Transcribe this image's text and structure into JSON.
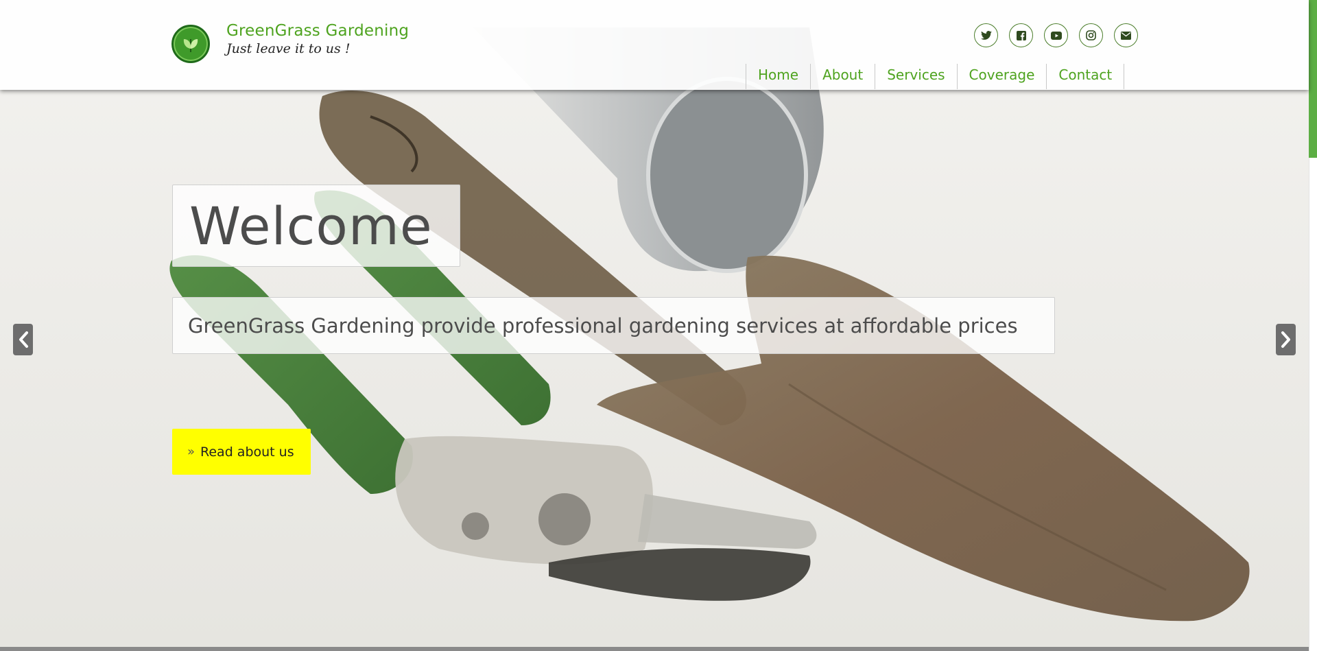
{
  "brand": {
    "title": "GreenGrass Gardening",
    "tagline": "Just leave it to us !",
    "accent_color": "#4ea31f"
  },
  "social": [
    {
      "icon": "twitter-icon"
    },
    {
      "icon": "facebook-icon"
    },
    {
      "icon": "youtube-icon"
    },
    {
      "icon": "instagram-icon"
    },
    {
      "icon": "email-icon"
    }
  ],
  "nav": {
    "items": [
      {
        "label": "Home"
      },
      {
        "label": "About"
      },
      {
        "label": "Services"
      },
      {
        "label": "Coverage"
      },
      {
        "label": "Contact"
      }
    ]
  },
  "hero": {
    "heading": "Welcome",
    "subheading": "GreenGrass Gardening provide professional gardening services at affordable prices",
    "cta_label": "Read about us",
    "cta_color": "#ffff00"
  },
  "carousel": {
    "prev_icon": "chevron-left-icon",
    "next_icon": "chevron-right-icon"
  }
}
